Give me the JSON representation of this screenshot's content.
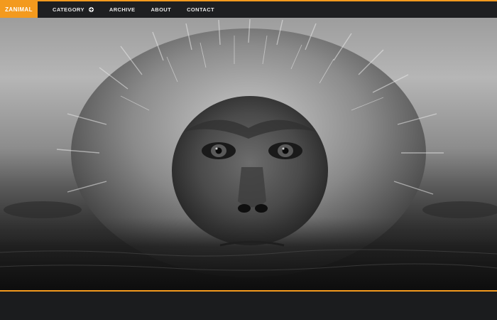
{
  "brand": {
    "logo_text": "ZANIMAL",
    "accent_color": "#f39a1e"
  },
  "nav": {
    "items": [
      {
        "label": "CATEGORY",
        "icon": "plus-circle-icon"
      },
      {
        "label": "ARCHIVE"
      },
      {
        "label": "ABOUT"
      },
      {
        "label": "CONTACT"
      }
    ]
  },
  "hero": {
    "image_subject": "monkey-face-photo"
  }
}
